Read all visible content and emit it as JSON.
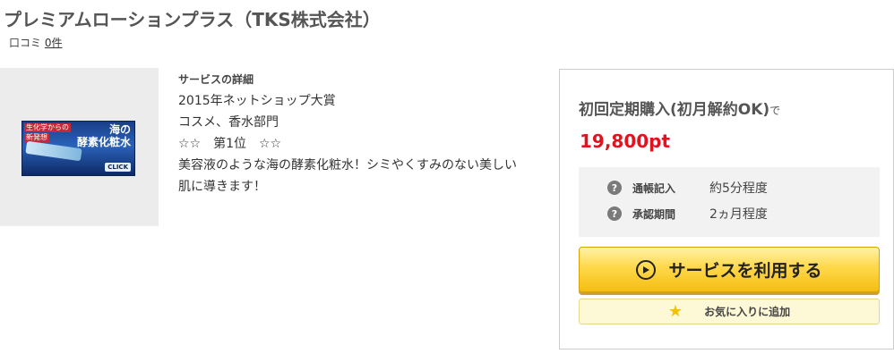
{
  "page": {
    "title": "プレミアムローションプラス（TKS株式会社）",
    "review_label": "口コミ",
    "review_count": "0件"
  },
  "banner": {
    "tag_line1": "生化学からの",
    "tag_line2": "新発想",
    "big_line1": "海の",
    "big_line2": "酵素化粧水",
    "click_label": "CLICK",
    "icon": "promo-banner"
  },
  "details": {
    "heading": "サービスの詳細",
    "lines": [
      "2015年ネットショップ大賞",
      "コスメ、香水部門",
      "☆☆　第1位　☆☆",
      "美容液のような海の酵素化粧水！シミやくすみのない美しい",
      "肌に導きます！"
    ]
  },
  "offer": {
    "title": "初回定期購入(初月解約OK)",
    "title_suffix": "で",
    "price": "19,800pt",
    "price_color": "#e0141e",
    "info": [
      {
        "icon": "question-icon",
        "label": "通帳記入",
        "value": "約5分程度"
      },
      {
        "icon": "question-icon",
        "label": "承認期間",
        "value": "2ヵ月程度"
      }
    ],
    "use_button_label": "サービスを利用する",
    "use_button_icon": "play-icon",
    "favorite_label": "お気に入りに追加",
    "favorite_icon": "star-icon"
  }
}
